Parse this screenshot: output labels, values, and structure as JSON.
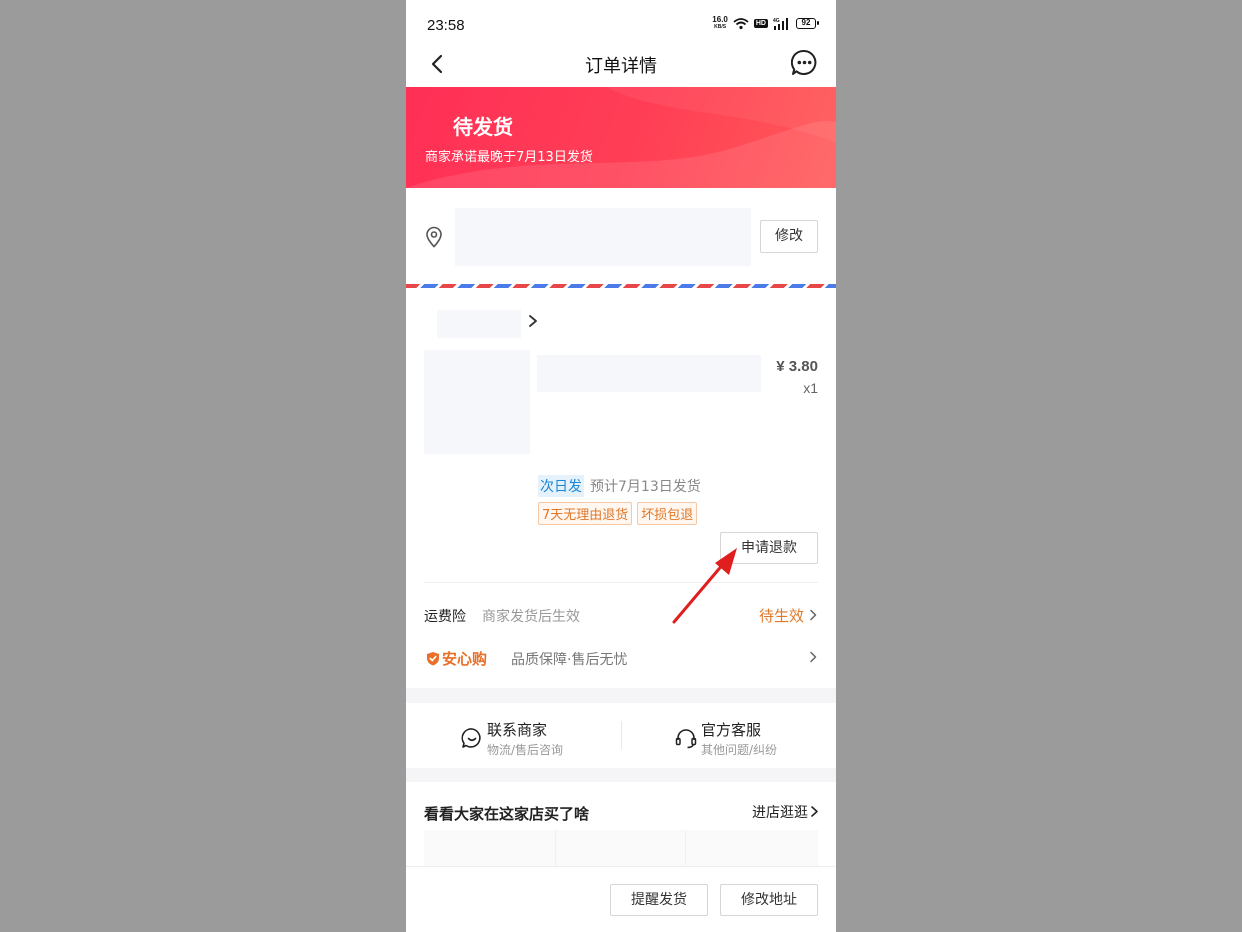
{
  "status_bar": {
    "time": "23:58",
    "net_speed": "16.0",
    "net_unit": "KB/S",
    "hd": "HD",
    "signal": "4G",
    "battery": "92"
  },
  "nav": {
    "title": "订单详情",
    "back_icon": "chevron-left-icon",
    "more_icon": "chat-more-icon"
  },
  "banner": {
    "state": "待发货",
    "promise": "商家承诺最晚于7月13日发货",
    "color": "#ff3655"
  },
  "address": {
    "edit_label": "修改"
  },
  "product": {
    "price": "¥ 3.80",
    "quantity": "x1",
    "shipping_tag": "次日发",
    "shipping_estimate": "预计7月13日发货",
    "service_tags": [
      "7天无理由退货",
      "坏损包退"
    ],
    "refund_label": "申请退款"
  },
  "insurance": {
    "label": "运费险",
    "desc": "商家发货后生效",
    "status": "待生效"
  },
  "anxingou": {
    "logo": "安心购",
    "desc": "品质保障·售后无忧"
  },
  "contact": {
    "merchant": {
      "title": "联系商家",
      "sub": "物流/售后咨询"
    },
    "service": {
      "title": "官方客服",
      "sub": "其他问题/纠纷"
    }
  },
  "recommend": {
    "title": "看看大家在这家店买了啥",
    "more": "进店逛逛"
  },
  "bottom": {
    "remind_label": "提醒发货",
    "change_address_label": "修改地址"
  },
  "colors": {
    "accent_red": "#ff3655",
    "orange": "#e0782a",
    "blue_tag": "#1a86d6",
    "annotation_arrow": "#e01e1e"
  }
}
